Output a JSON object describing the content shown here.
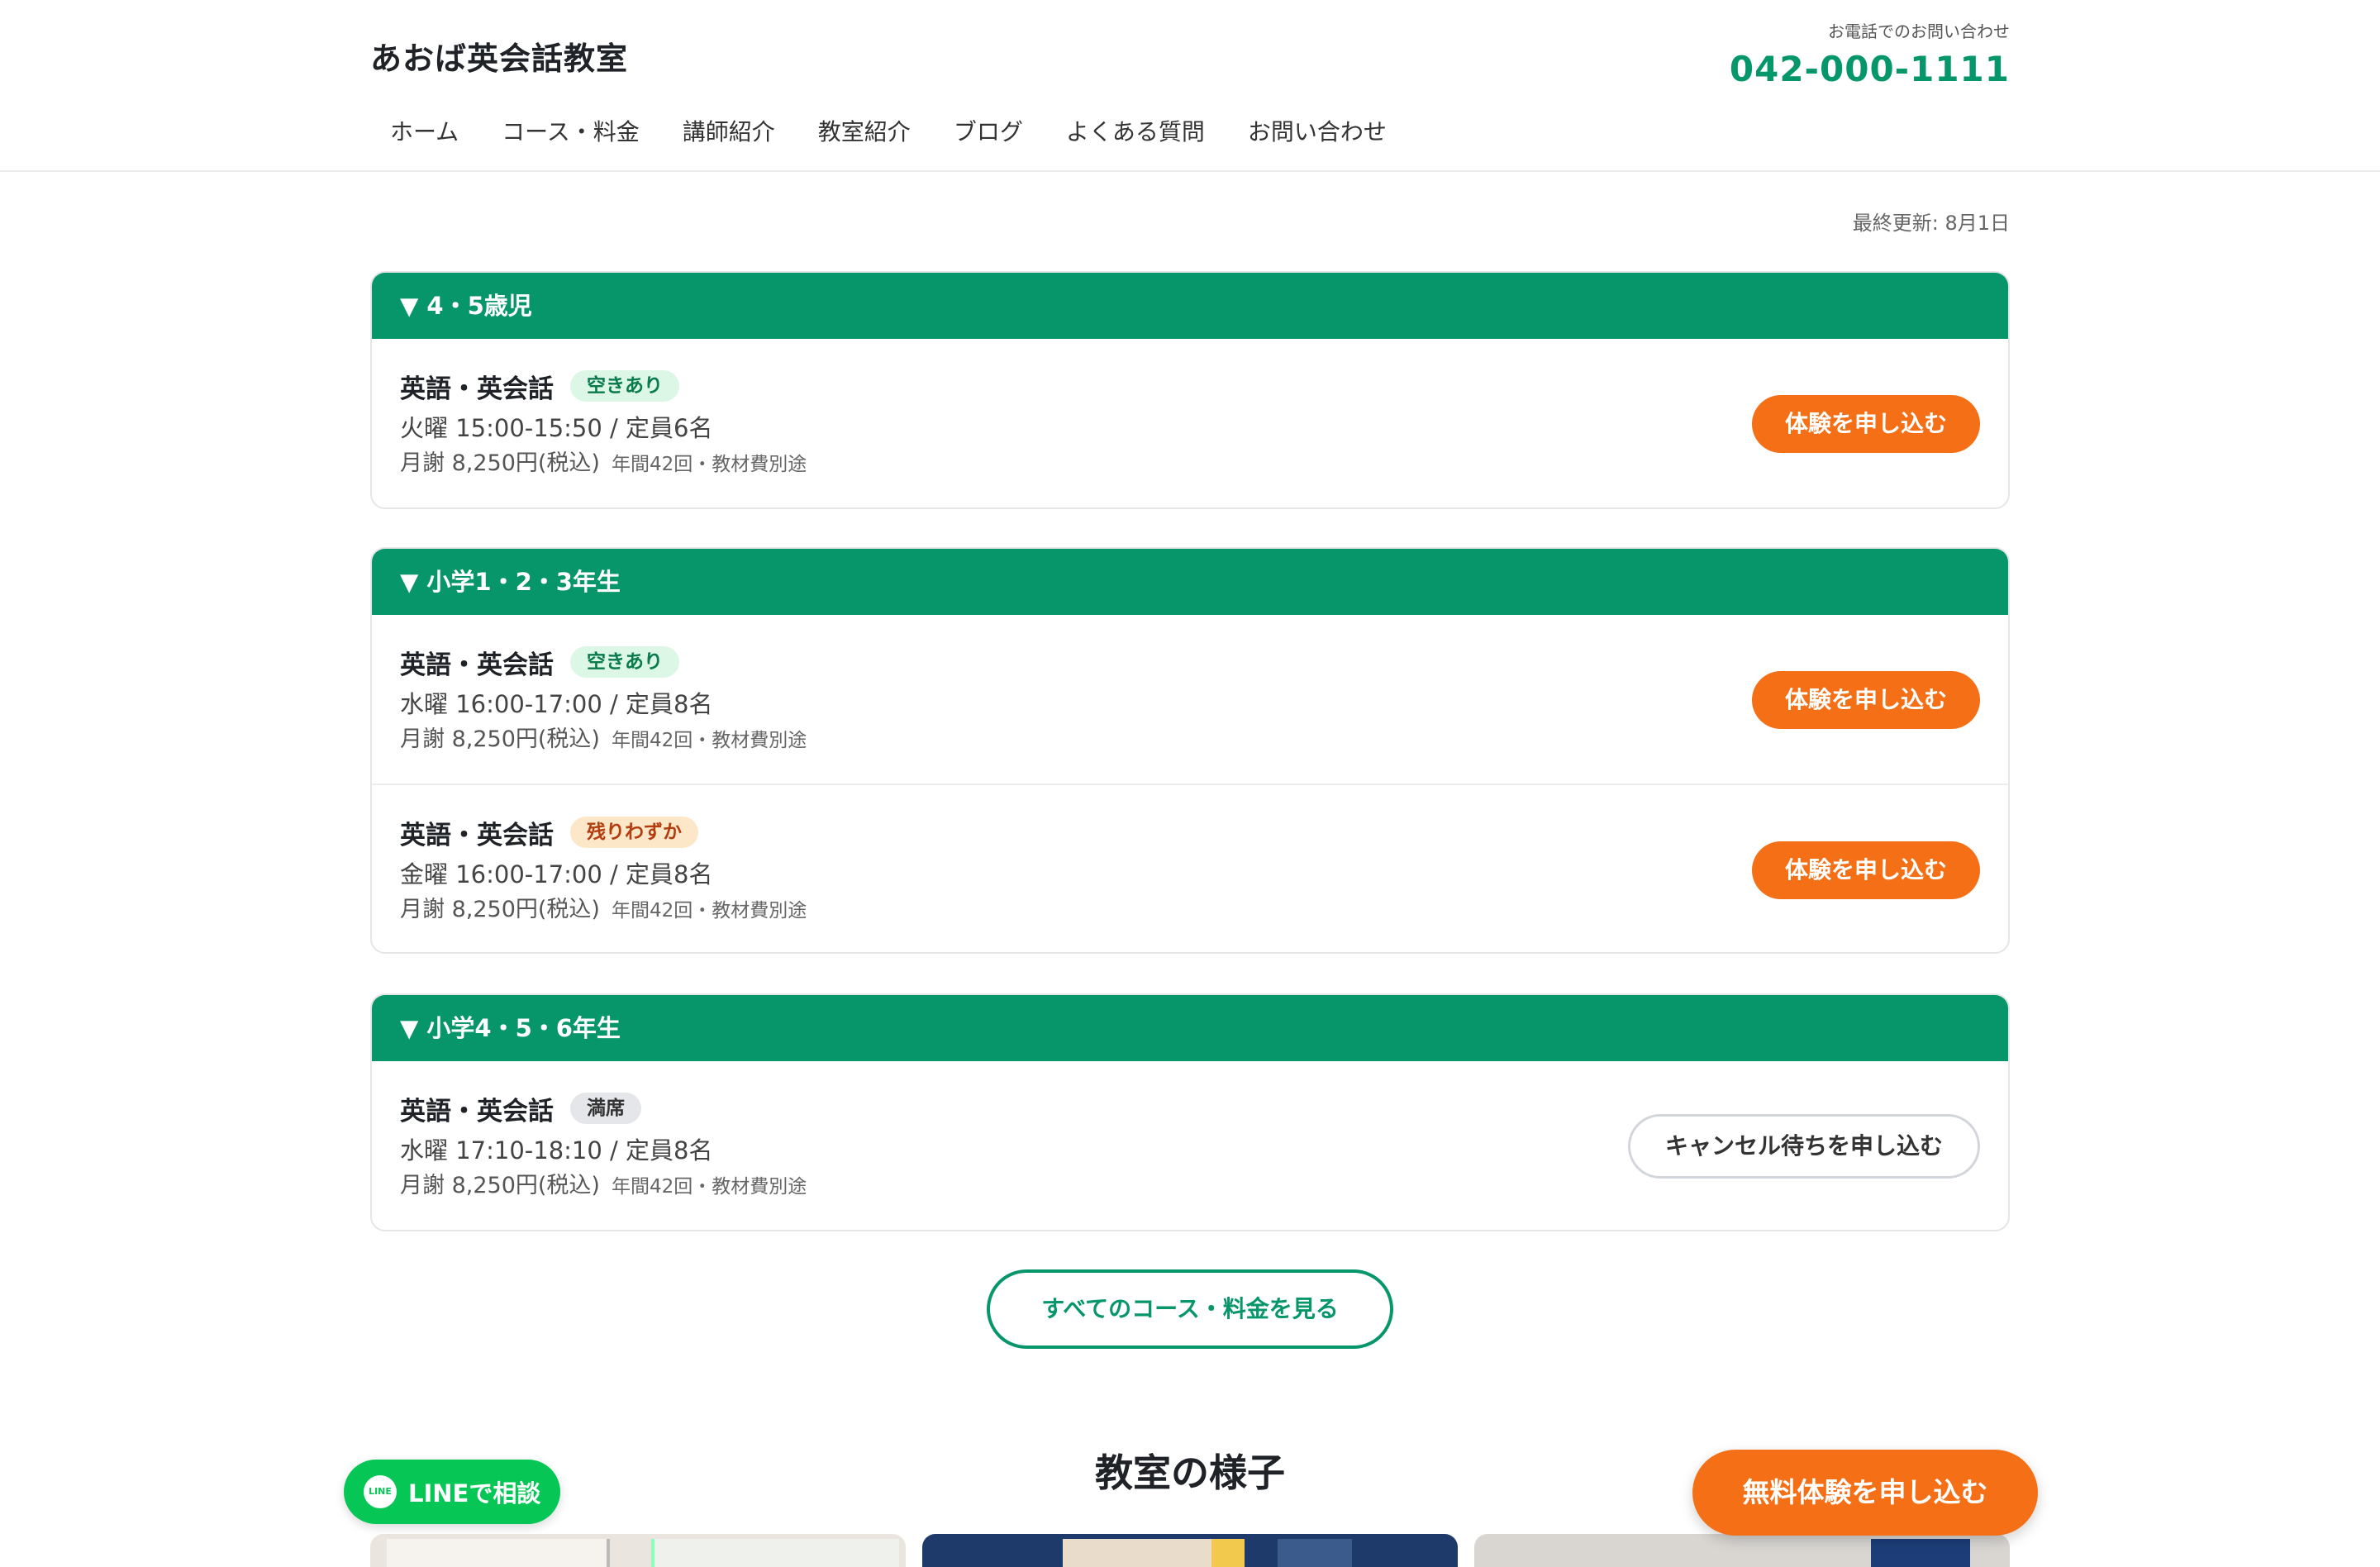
{
  "header": {
    "site_title": "あおば英会話教室",
    "nav": [
      "ホーム",
      "コース・料金",
      "講師紹介",
      "教室紹介",
      "ブログ",
      "よくある質問",
      "お問い合わせ"
    ],
    "contact_label": "お電話でのお問い合わせ",
    "contact_phone": "042-000-1111"
  },
  "updated": "最終更新: 8月1日",
  "groups": [
    {
      "title": "▼ 4・5歳児",
      "courses": [
        {
          "name": "英語・英会話",
          "badge": "空きあり",
          "time": "火曜 15:00-15:50 / 定員6名",
          "fee": "月謝 8,250円(税込)",
          "note": "年間42回・教材費別途",
          "action": "体験を申し込む"
        }
      ]
    },
    {
      "title": "▼ 小学1・2・3年生",
      "courses": [
        {
          "name": "英語・英会話",
          "badge": "空きあり",
          "time": "水曜 16:00-17:00 / 定員8名",
          "fee": "月謝 8,250円(税込)",
          "note": "年間42回・教材費別途",
          "action": "体験を申し込む"
        },
        {
          "name": "英語・英会話",
          "badge": "残りわずか",
          "time": "金曜 16:00-17:00 / 定員8名",
          "fee": "月謝 8,250円(税込)",
          "note": "年間42回・教材費別途",
          "action": "体験を申し込む"
        }
      ]
    },
    {
      "title": "▼ 小学4・5・6年生",
      "courses": [
        {
          "name": "英語・英会話",
          "badge": "満席",
          "time": "水曜 17:10-18:10 / 定員8名",
          "fee": "月謝 8,250円(税込)",
          "note": "年間42回・教材費別途",
          "action": "キャンセル待ちを申し込む"
        }
      ]
    }
  ],
  "all_courses_button": "すべてのコース・料金を見る",
  "section_title": "教室の様子",
  "line_button": "LINEで相談",
  "line_icon_text": "LINE",
  "trial_button": "無料体験を申し込む",
  "colors": {
    "brand_green": "#07966a",
    "accent_orange": "#f56f16",
    "line_green": "#06c755"
  }
}
